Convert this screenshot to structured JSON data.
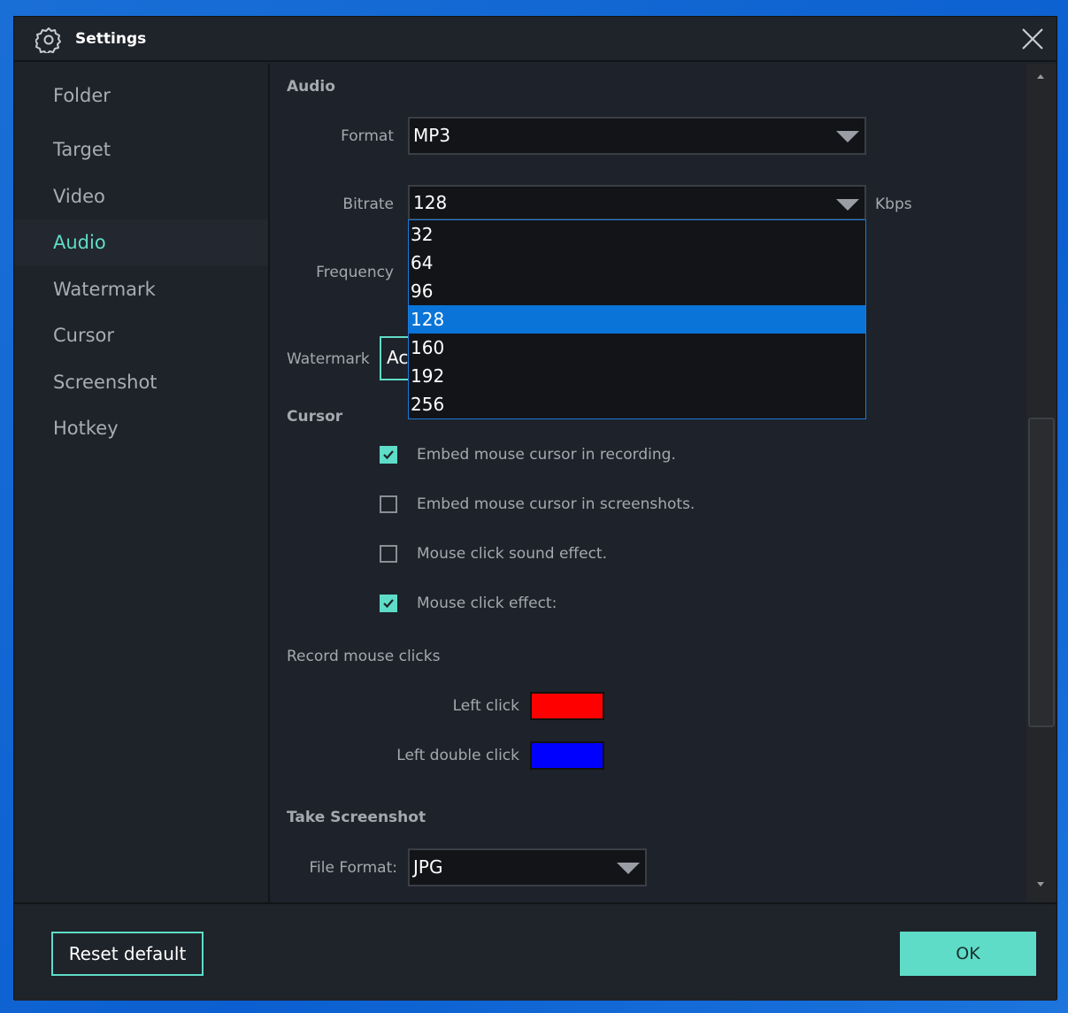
{
  "window": {
    "title": "Settings",
    "icon": "gear-icon",
    "close_icon": "close-icon"
  },
  "sidebar": {
    "items": [
      {
        "label": "Folder"
      },
      {
        "label": "Target"
      },
      {
        "label": "Video"
      },
      {
        "label": "Audio",
        "active": true
      },
      {
        "label": "Watermark"
      },
      {
        "label": "Cursor"
      },
      {
        "label": "Screenshot"
      },
      {
        "label": "Hotkey"
      }
    ]
  },
  "audio": {
    "section": "Audio",
    "format_label": "Format",
    "format_value": "MP3",
    "bitrate_label": "Bitrate",
    "bitrate_value": "128",
    "bitrate_unit": "Kbps",
    "frequency_label": "Frequency",
    "bitrate_options": [
      "32",
      "64",
      "96",
      "128",
      "160",
      "192",
      "256"
    ],
    "selected_option": "128"
  },
  "watermark": {
    "label": "Watermark",
    "button_partial": "Ac"
  },
  "cursor": {
    "section": "Cursor",
    "options": [
      {
        "label": "Embed mouse cursor in recording.",
        "checked": true
      },
      {
        "label": "Embed mouse cursor in screenshots.",
        "checked": false
      },
      {
        "label": "Mouse click sound effect.",
        "checked": false
      },
      {
        "label": "Mouse click effect:",
        "checked": true
      }
    ],
    "record_label": "Record mouse clicks",
    "left_click_label": "Left click",
    "left_click_color": "#ff0000",
    "double_click_label": "Left double click",
    "double_click_color": "#0000ff"
  },
  "screenshot": {
    "section": "Take Screenshot",
    "file_format_label": "File Format:",
    "file_format_value": "JPG"
  },
  "footer": {
    "reset_label": "Reset default",
    "ok_label": "OK"
  },
  "colors": {
    "accent": "#5fdcc8",
    "highlight": "#0a74d8"
  }
}
